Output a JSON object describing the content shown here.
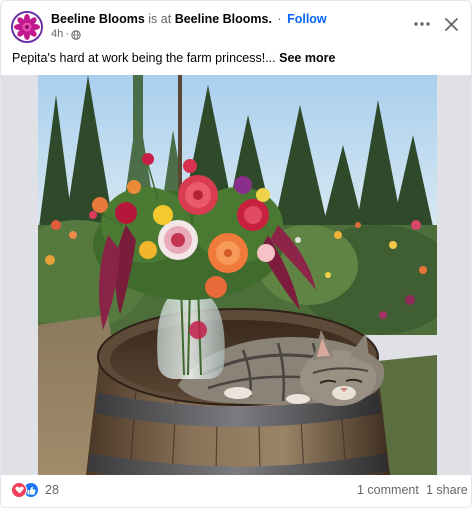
{
  "post": {
    "author": "Beeline Blooms",
    "is_at": "is at",
    "location": "Beeline Blooms.",
    "separator": "·",
    "follow_label": "Follow",
    "time": "4h",
    "time_separator": "·",
    "caption_text": "Pepita's hard at work being the farm princess!...",
    "see_more_label": "See more",
    "reaction_count": "28",
    "comments_label": "1 comment",
    "shares_label": "1 share"
  },
  "icons": {
    "avatar": "dahlia-flower-avatar",
    "audience": "globe-icon",
    "more": "more-options-icon",
    "close": "close-icon",
    "reaction_1": "love-reaction-icon",
    "reaction_2": "like-reaction-icon"
  },
  "colors": {
    "follow_blue": "#0866ff",
    "like_blue": "#1877f2",
    "love_red": "#f33e58",
    "muted_text": "#65676b"
  }
}
